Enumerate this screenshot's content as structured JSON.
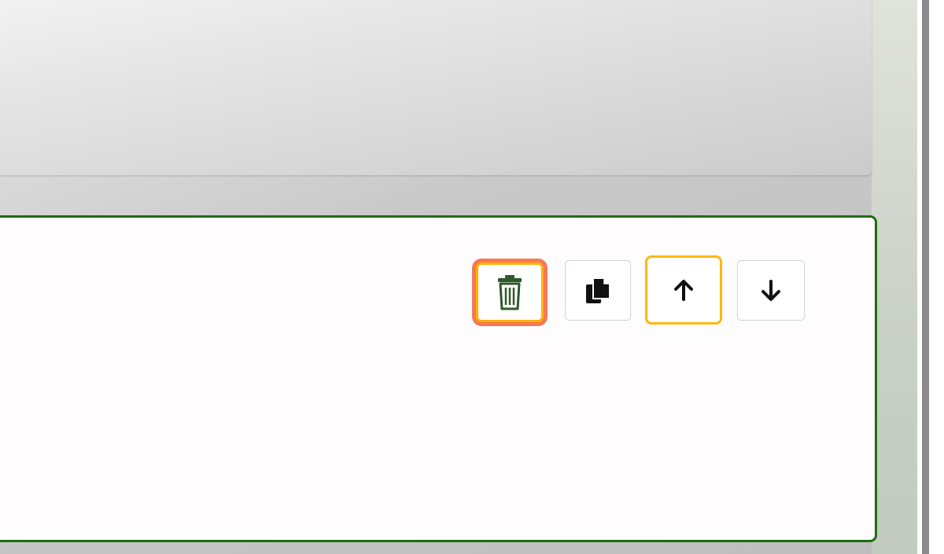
{
  "screen": {
    "description_hidden": ""
  },
  "card": {
    "border_color": "#1f6b14",
    "background": "#fefcfd"
  },
  "actions": {
    "delete": {
      "icon": "trash-icon",
      "label": ""
    },
    "copy": {
      "icon": "copy-icon",
      "label": ""
    },
    "move_up": {
      "icon": "arrow-up-icon",
      "label": ""
    },
    "move_down": {
      "icon": "arrow-down-icon",
      "label": ""
    }
  },
  "colors": {
    "focus_outline": "#ffb000",
    "highlight_ring": "#f47a54",
    "trash_icon": "#2f5a2a",
    "icon_dark": "#111111"
  }
}
